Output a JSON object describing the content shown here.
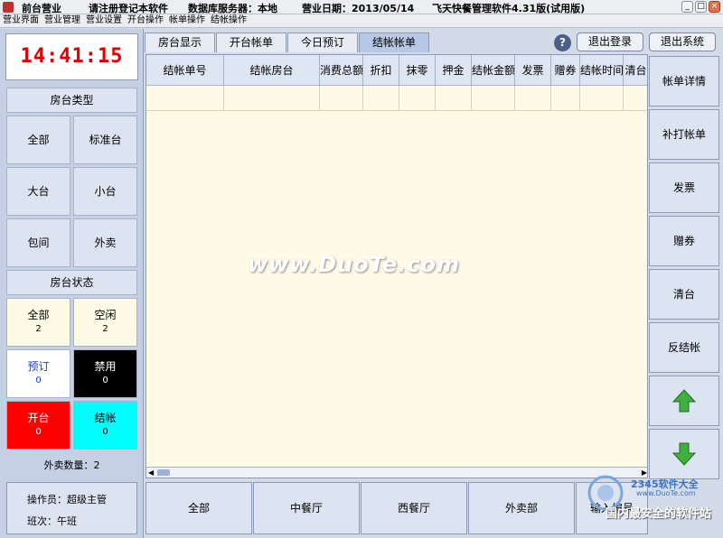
{
  "titlebar": {
    "app_title": "前台营业",
    "notice": "请注册登记本软件",
    "db_server": "数据库服务器：本地",
    "business_date": "营业日期：2013/05/14",
    "product": "飞天快餐管理软件4.31版(试用版)"
  },
  "menu": [
    "营业界面",
    "营业管理",
    "营业设置",
    "开台操作",
    "帐单操作",
    "结帐操作"
  ],
  "clock": "14:41:15",
  "room_type": {
    "header": "房台类型",
    "buttons": [
      "全部",
      "标准台",
      "大台",
      "小台",
      "包间",
      "外卖"
    ]
  },
  "room_status": {
    "header": "房台状态",
    "items": [
      {
        "label": "全部",
        "count": "2",
        "bg": "#fdfbe5",
        "fg": "#000000"
      },
      {
        "label": "空闲",
        "count": "2",
        "bg": "#fdfbe5",
        "fg": "#000000"
      },
      {
        "label": "预订",
        "count": "0",
        "bg": "#ffffff",
        "fg": "#1a3cc8"
      },
      {
        "label": "禁用",
        "count": "0",
        "bg": "#000000",
        "fg": "#ffffff"
      },
      {
        "label": "开台",
        "count": "0",
        "bg": "#ff0000",
        "fg": "#ffffff"
      },
      {
        "label": "结帐",
        "count": "0",
        "bg": "#00ffff",
        "fg": "#000000"
      }
    ]
  },
  "takeout_count": "外卖数量：2",
  "operator": {
    "label": "操作员：超级主管",
    "shift": "班次：午班"
  },
  "tabs": [
    "房台显示",
    "开台帐单",
    "今日预订",
    "结帐帐单"
  ],
  "active_tab": 3,
  "help_icon": "?",
  "top_buttons": {
    "logout": "退出登录",
    "exit": "退出系统"
  },
  "table": {
    "columns": [
      "结帐单号",
      "结帐房台",
      "消费总额",
      "折扣",
      "抹零",
      "押金",
      "结帐金额",
      "发票",
      "赠券",
      "结帐时间",
      "清台"
    ]
  },
  "watermark": "www.DuoTe.com",
  "right_buttons": [
    "帐单详情",
    "补打帐单",
    "发票",
    "赠券",
    "清台",
    "反结帐"
  ],
  "bottom_buttons": [
    "全部",
    "中餐厅",
    "西餐厅",
    "外卖部",
    "输入编号"
  ],
  "logo_watermark": {
    "brand": "2345软件大全",
    "url": "www.DuoTe.com",
    "slogan": "国内最安全的软件站"
  },
  "colors": {
    "panel": "#c5d0e4",
    "table_bg": "#fdfbe5",
    "clock_text": "#e00000",
    "arrow": "#3fb03f"
  }
}
